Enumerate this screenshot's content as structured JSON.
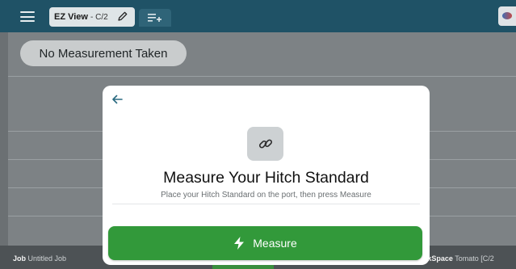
{
  "header": {
    "tab_title": "EZ View",
    "tab_suffix": " - C/2",
    "icons": [
      "menu-icon",
      "pencil-icon",
      "add-list-icon",
      "app-logo-icon"
    ]
  },
  "main": {
    "status_pill": "No Measurement Taken"
  },
  "modal": {
    "title": "Measure Your Hitch Standard",
    "subtitle": "Place your Hitch Standard on the port, then press Measure",
    "button_label": "Measure",
    "icons": [
      "back-arrow-icon",
      "link-icon",
      "lightning-icon"
    ]
  },
  "status_bar": {
    "job_label": "Job",
    "job_value": "Untitled Job",
    "workspace_label": "WorkSpace",
    "workspace_value": "Tomato [C/2"
  },
  "colors": {
    "header_bg": "#1f5266",
    "accent_green": "#32993a",
    "back_arrow": "#2a6a80"
  }
}
